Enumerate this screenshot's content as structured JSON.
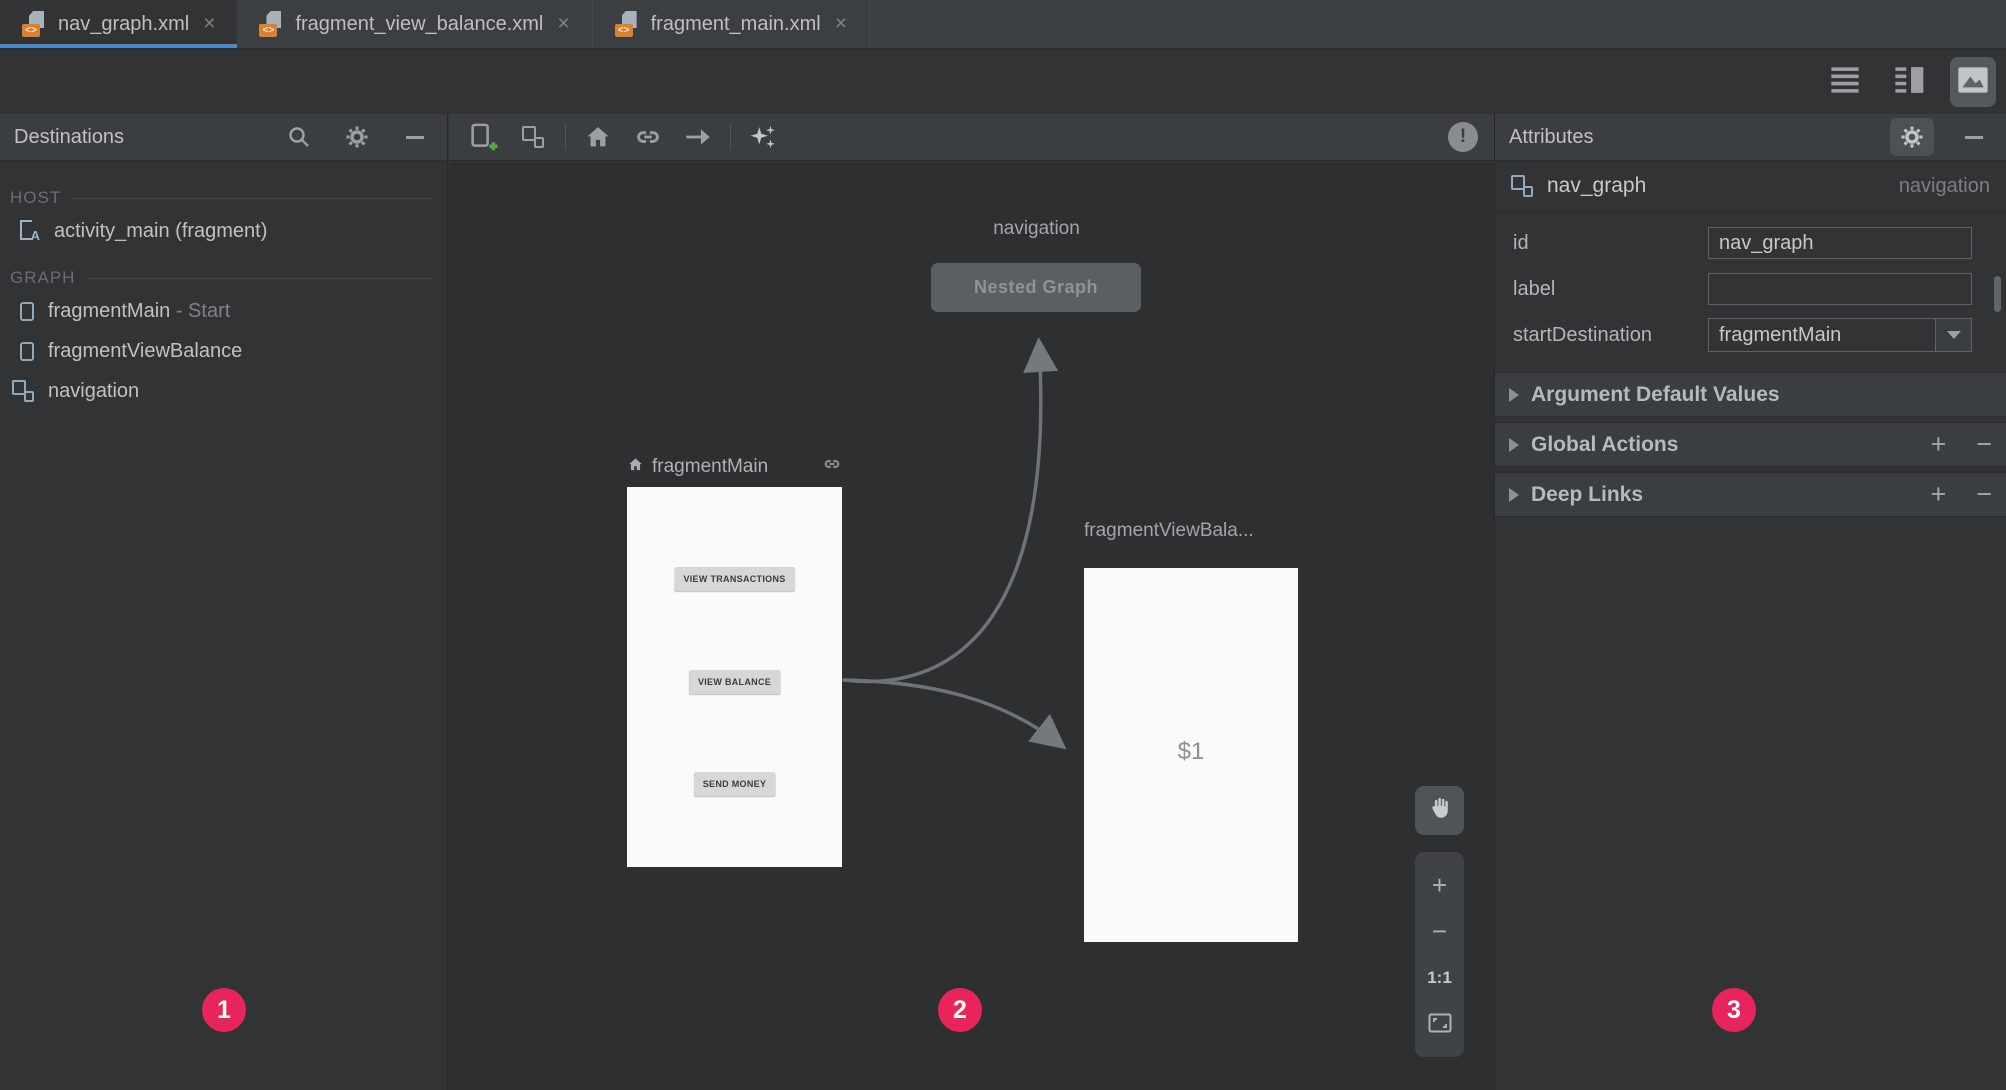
{
  "tabs": [
    {
      "label": "nav_graph.xml",
      "selected": true
    },
    {
      "label": "fragment_view_balance.xml",
      "selected": false
    },
    {
      "label": "fragment_main.xml",
      "selected": false
    }
  ],
  "glyphs": {
    "close": "×",
    "plus": "+",
    "minus": "−",
    "xml": "<>",
    "exclamation": "!"
  },
  "destinations": {
    "title": "Destinations",
    "host_label": "HOST",
    "graph_label": "GRAPH",
    "host_items": [
      {
        "label": "activity_main (fragment)"
      }
    ],
    "graph_items": [
      {
        "label": "fragmentMain",
        "suffix": " - Start"
      },
      {
        "label": "fragmentViewBalance",
        "suffix": ""
      },
      {
        "label": "navigation",
        "suffix": ""
      }
    ]
  },
  "canvas": {
    "nested": {
      "caption": "navigation",
      "button": "Nested Graph"
    },
    "fragment_main": {
      "caption": "fragmentMain",
      "buttons": [
        "VIEW TRANSACTIONS",
        "VIEW BALANCE",
        "SEND MONEY"
      ]
    },
    "fragment_view_balance": {
      "caption": "fragmentViewBala...",
      "content": "$1"
    }
  },
  "zoom_controls": {
    "ratio": "1:1"
  },
  "badges": [
    "1",
    "2",
    "3"
  ],
  "attributes": {
    "title": "Attributes",
    "component": {
      "name": "nav_graph",
      "type": "navigation"
    },
    "fields": [
      {
        "label": "id",
        "value": "nav_graph"
      },
      {
        "label": "label",
        "value": ""
      },
      {
        "label": "startDestination",
        "value": "fragmentMain"
      }
    ],
    "sections": [
      {
        "label": "Argument Default Values",
        "has_actions": false
      },
      {
        "label": "Global Actions",
        "has_actions": true
      },
      {
        "label": "Deep Links",
        "has_actions": true
      }
    ]
  },
  "colors": {
    "badge_accent": "#E8245C",
    "tab_underline": "#4A88C7",
    "card_bg": "#FAFAFA",
    "canvas_bg": "#2D2F31",
    "panel_bg": "#313335",
    "header_bg": "#3B3E40",
    "arrow": "#6E7376"
  }
}
